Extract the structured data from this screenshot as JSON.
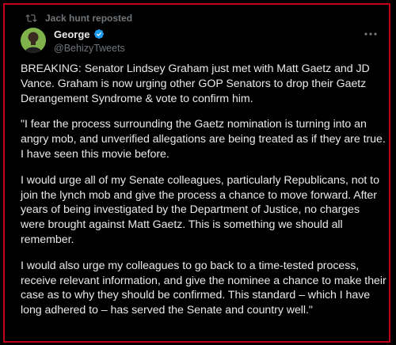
{
  "repost": {
    "text": "Jack hunt reposted",
    "icon": "repost-icon"
  },
  "author": {
    "display_name": "George",
    "handle": "@BehizyTweets",
    "verified": true,
    "verified_color": "#1d9bf0",
    "avatar_icon": "avatar-photo"
  },
  "more_icon": "more-options-icon",
  "tweet": {
    "paragraphs": [
      "BREAKING: Senator Lindsey Graham just met with Matt Gaetz and JD Vance. Graham is now urging other GOP Senators to drop their Gaetz Derangement Syndrome & vote to confirm him.",
      "\"I fear the process surrounding the Gaetz nomination is turning into an angry mob, and unverified allegations are being treated as if they are true. I have seen this movie before.",
      "I would urge all of my Senate colleagues, particularly Republicans, not to join the lynch mob and give the process a chance to move forward. After years of being investigated by the Department of Justice, no charges were brought against Matt Gaetz. This is something we should all remember.",
      "I would also urge my colleagues to go back to a time-tested process, receive relevant information, and give the nominee a chance to make their case as to why they should be confirmed. This standard – which I have long adhered to – has served the Senate and country well.\""
    ]
  },
  "colors": {
    "background": "#000000",
    "frame_border": "#c2001a",
    "text_primary": "#e7e9ea",
    "text_secondary": "#71767b",
    "verified": "#1d9bf0",
    "avatar_background": "#7fb24a"
  }
}
